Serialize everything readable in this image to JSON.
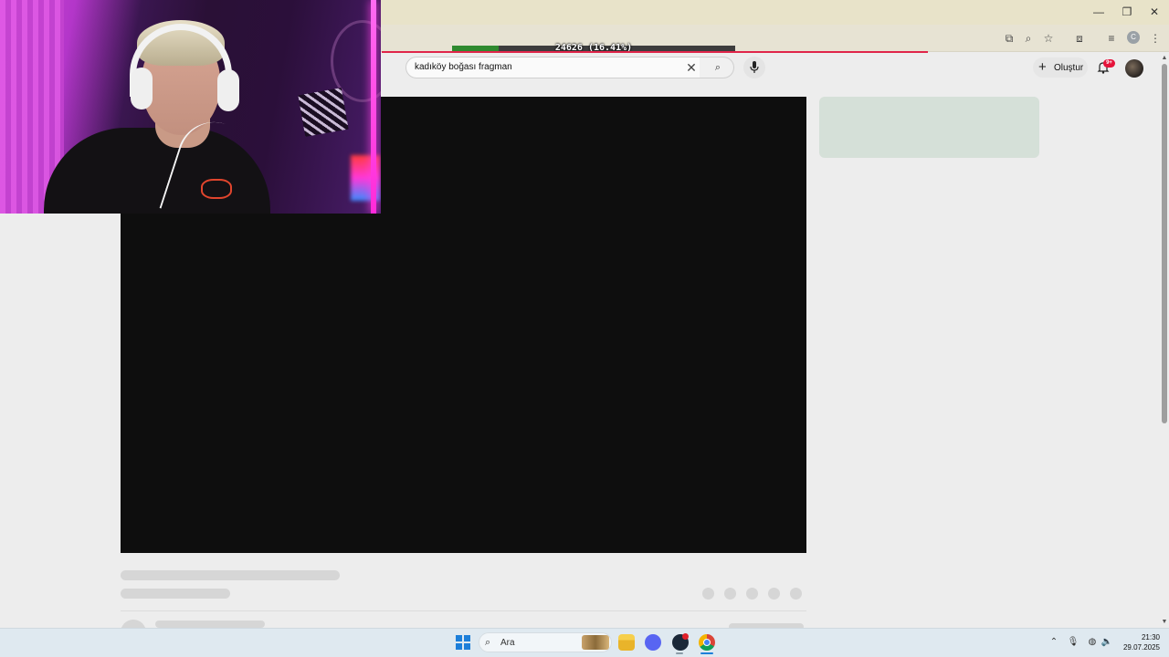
{
  "browser": {
    "window_controls": {
      "minimize": "—",
      "maximize": "❐",
      "close": "✕"
    },
    "profile_initial": "C"
  },
  "overlay": {
    "progress_text": "24626 (16.41%)",
    "progress_fraction": 0.1641
  },
  "youtube": {
    "search": {
      "value": "kadıköy boğası fragman"
    },
    "create_label": "Oluştur",
    "notification_badge": "9+"
  },
  "taskbar": {
    "search_placeholder": "Ara",
    "clock": {
      "time": "21:30",
      "date": "29.07.2025"
    }
  },
  "colors": {
    "accent_red": "#e0254a",
    "progress_green": "#2f8a2f",
    "windows_blue": "#1d7fd9"
  }
}
